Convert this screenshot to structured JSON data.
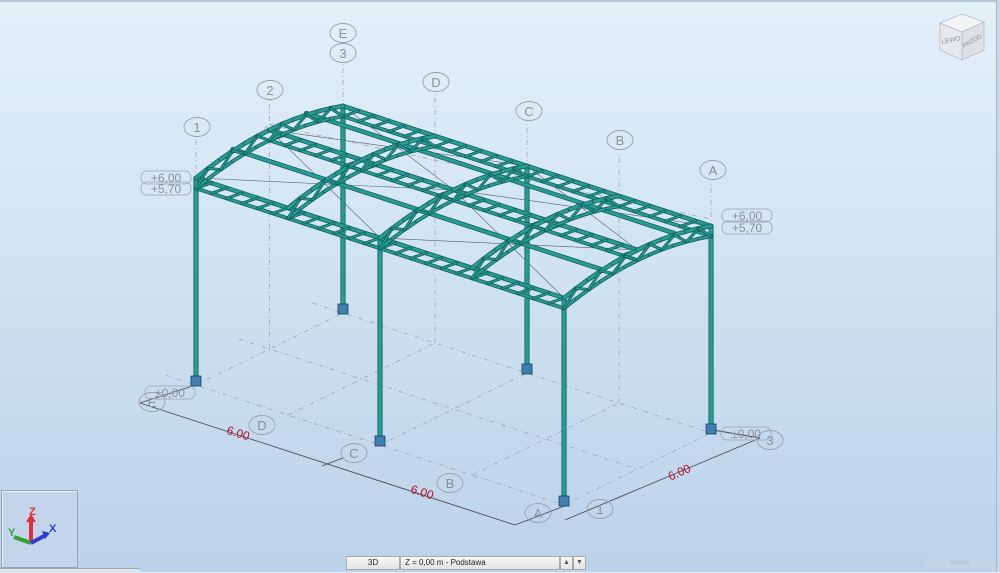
{
  "model": {
    "member_color": "#2a9a94",
    "member_outline": "#0f625e",
    "support_color": "#3f7fb0",
    "grid_axes_long": [
      "E",
      "D",
      "C",
      "B",
      "A"
    ],
    "grid_axes_short": [
      "1",
      "2",
      "3"
    ],
    "levels": {
      "eave_top": "+6,00",
      "eave_bottom": "+5,70",
      "ground_left": "±0,00",
      "ground_right": "±0,00"
    },
    "dimensions": {
      "left_bay_1": "6.00",
      "left_bay_2": "6.00",
      "right_span": "6.00"
    },
    "dimension_color": "#b0122a"
  },
  "viewcube": {
    "left_face": "LEWO",
    "front_face": "PRZÓD"
  },
  "triad": {
    "x": "X",
    "y": "Y",
    "z": "Z"
  },
  "bottom_bar": {
    "view_mode": "3D",
    "level": "Z = 0,00 m - Podstawa",
    "up_arrow": "▲",
    "down_arrow": "▼",
    "right_label": "Widok"
  }
}
